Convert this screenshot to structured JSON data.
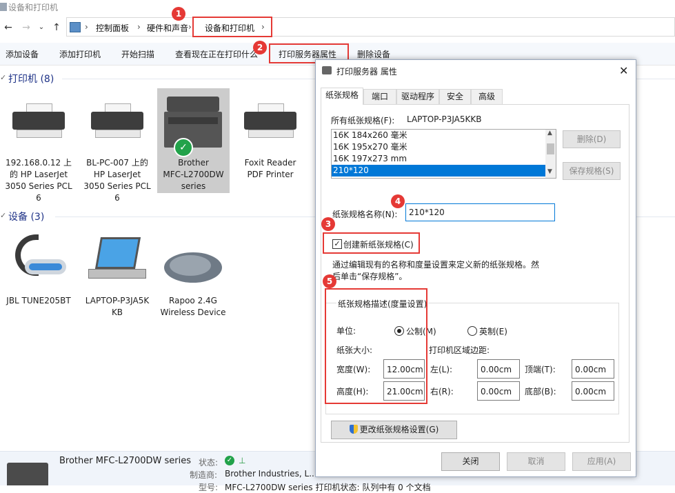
{
  "window": {
    "title": "设备和打印机"
  },
  "address": {
    "crumbs": [
      "控制面板",
      "硬件和声音",
      "设备和打印机"
    ],
    "sep": "›"
  },
  "toolbar": {
    "items": [
      "添加设备",
      "添加打印机",
      "开始扫描",
      "查看现在正在打印什么",
      "打印服务器属性",
      "删除设备"
    ]
  },
  "printers": {
    "header": "打印机 (8)",
    "items": [
      {
        "label": [
          "192.168.0.12 上",
          "的 HP LaserJet",
          "3050 Series PCL",
          "6"
        ]
      },
      {
        "label": [
          "BL-PC-007 上的",
          "HP LaserJet",
          "3050 Series PCL",
          "6"
        ]
      },
      {
        "label": [
          "Brother",
          "MFC-L2700DW",
          "series"
        ]
      },
      {
        "label": [
          "Foxit Reader",
          "PDF Printer"
        ]
      }
    ]
  },
  "devices": {
    "header": "设备 (3)",
    "items": [
      {
        "label": [
          "JBL TUNE205BT"
        ]
      },
      {
        "label": [
          "LAPTOP-P3JA5K",
          "KB"
        ]
      },
      {
        "label": [
          "Rapoo 2.4G",
          "Wireless Device"
        ]
      }
    ]
  },
  "details": {
    "name": "Brother MFC-L2700DW series",
    "status_label": "状态:",
    "maker_label": "制造商:",
    "maker": "Brother Industries, L...",
    "model_label": "型号:",
    "model": "MFC-L2700DW series 打印机状态: 队列中有 0 个文档"
  },
  "annotations": [
    "1",
    "2",
    "3",
    "4",
    "5"
  ],
  "dialog": {
    "title": "打印服务器 属性",
    "tabs": [
      "纸张规格",
      "端口",
      "驱动程序",
      "安全",
      "高级"
    ],
    "all_forms_label": "所有纸张规格(F):",
    "computer": "LAPTOP-P3JA5KKB",
    "forms": [
      "16K 184x260 毫米",
      "16K 195x270 毫米",
      "16K 197x273 mm",
      "210*120"
    ],
    "selected_form": "210*120",
    "delete_btn": "删除(D)",
    "save_btn": "保存规格(S)",
    "form_name_label": "纸张规格名称(N):",
    "form_name_value": "210*120",
    "create_new_label": "创建新纸张规格(C)",
    "create_new_checked": true,
    "hint": "通过编辑现有的名称和度量设置来定义新的纸张规格。然后单击“保存规格”。",
    "group_title": "纸张规格描述(度量设置)",
    "unit_label": "单位:",
    "metric_label": "公制(M)",
    "english_label": "英制(E)",
    "paper_size_label": "纸张大小:",
    "margins_label": "打印机区域边距:",
    "width_label": "宽度(W):",
    "width_value": "12.00cm",
    "height_label": "高度(H):",
    "height_value": "21.00cm",
    "left_label": "左(L):",
    "left_value": "0.00cm",
    "right_label": "右(R):",
    "right_value": "0.00cm",
    "top_label": "顶端(T):",
    "top_value": "0.00cm",
    "bottom_label": "底部(B):",
    "bottom_value": "0.00cm",
    "change_btn": "更改纸张规格设置(G)",
    "close_btn": "关闭",
    "cancel_btn": "取消",
    "apply_btn": "应用(A)"
  },
  "colors": {
    "accent": "#0078d7",
    "highlight": "#e53935",
    "header": "#1e3287"
  }
}
